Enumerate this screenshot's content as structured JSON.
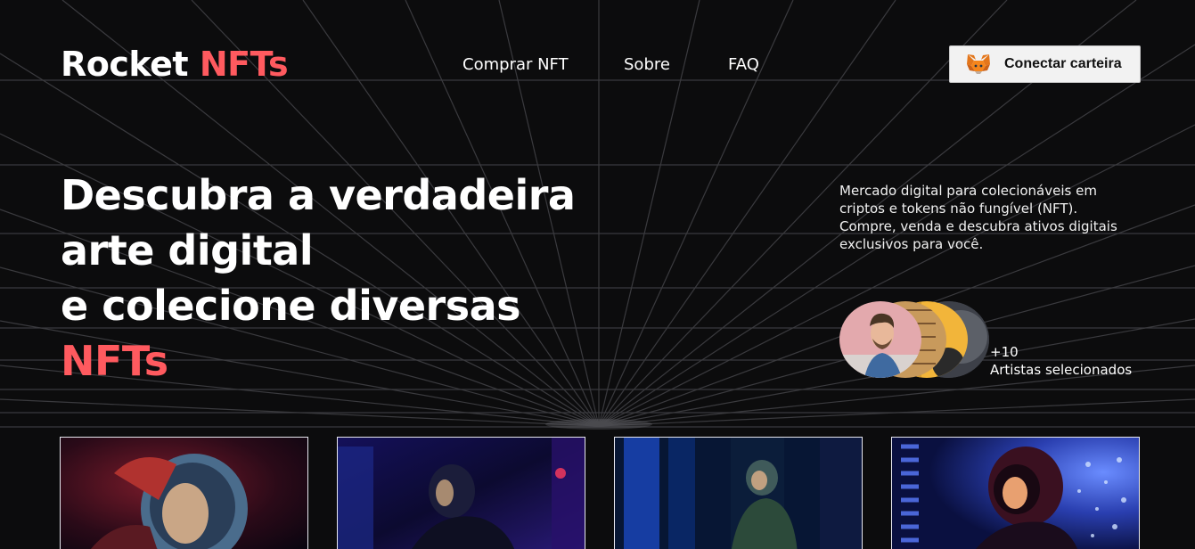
{
  "brand": {
    "name": "Rocket",
    "accent": "NFTs",
    "accent_color": "#ff5a5f"
  },
  "nav": {
    "items": [
      {
        "label": "Comprar NFT"
      },
      {
        "label": "Sobre"
      },
      {
        "label": "FAQ"
      }
    ]
  },
  "wallet_button": {
    "label": "Conectar carteira",
    "icon": "metamask-fox-icon"
  },
  "hero": {
    "lines": [
      "Descubra a verdadeira",
      "arte digital",
      "e colecione diversas"
    ],
    "accent": "NFTs"
  },
  "description": {
    "lines": [
      "Mercado digital para colecionáveis em",
      "criptos e tokens não fungível (NFT).",
      "Compre, venda e descubra ativos digitais",
      "exclusivos para você."
    ]
  },
  "artists": {
    "count": "+10",
    "label": "Artistas selecionados"
  },
  "cards": [
    {
      "name": "nft-card-astronaut-red"
    },
    {
      "name": "nft-card-astronaut-blue"
    },
    {
      "name": "nft-card-astronaut-green"
    },
    {
      "name": "nft-card-astronaut-lights"
    }
  ]
}
